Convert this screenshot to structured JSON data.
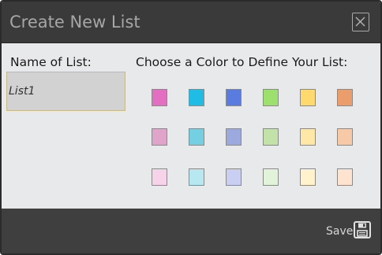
{
  "dialog": {
    "title": "Create New List",
    "close_icon": "close-icon"
  },
  "name_field": {
    "label": "Name of List:",
    "value": "List1"
  },
  "color_picker": {
    "label": "Choose a Color to Define Your List:",
    "rows": [
      [
        "#e26fbf",
        "#1fbde6",
        "#5a7be0",
        "#9ee06d",
        "#ffd86e",
        "#eb9e6b"
      ],
      [
        "#e0a4cb",
        "#74cfe3",
        "#9ba9df",
        "#c3e2a9",
        "#ffe7a7",
        "#f7c9a6"
      ],
      [
        "#f7d3ea",
        "#b7e8f1",
        "#c9cff2",
        "#e1f3d8",
        "#fff2cc",
        "#fde3d0"
      ]
    ]
  },
  "footer": {
    "save_label": "Save",
    "save_icon": "floppy-disk-icon"
  },
  "colors": {
    "titlebar_bg": "#3a3a3a",
    "body_bg": "#e8e9eb",
    "footer_bg": "#3f3f3f"
  }
}
